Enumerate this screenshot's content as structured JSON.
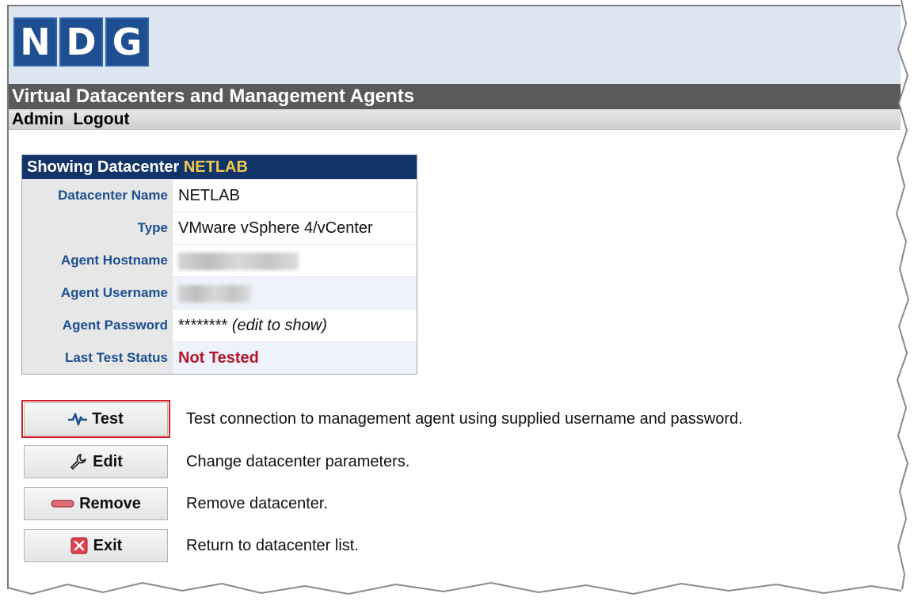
{
  "logo": {
    "letters": [
      "N",
      "D",
      "G"
    ],
    "brand_color": "#1d4f91"
  },
  "app_title": "Virtual Datacenters and Management Agents",
  "menu": {
    "admin": "Admin",
    "logout": "Logout"
  },
  "panel": {
    "title_prefix": "Showing Datacenter",
    "title_name": "NETLAB",
    "rows": [
      {
        "label": "Datacenter Name",
        "value": "NETLAB"
      },
      {
        "label": "Type",
        "value": "VMware vSphere 4/vCenter"
      },
      {
        "label": "Agent Hostname",
        "value": ""
      },
      {
        "label": "Agent Username",
        "value": ""
      },
      {
        "label": "Agent Password",
        "value": "********",
        "note": "(edit to show)"
      },
      {
        "label": "Last Test Status",
        "value": "Not Tested"
      }
    ]
  },
  "actions": [
    {
      "label": "Test",
      "icon": "pulse-icon",
      "description": "Test connection to management agent using supplied username and password."
    },
    {
      "label": "Edit",
      "icon": "wrench-icon",
      "description": "Change datacenter parameters."
    },
    {
      "label": "Remove",
      "icon": "minus-icon",
      "description": "Remove datacenter."
    },
    {
      "label": "Exit",
      "icon": "close-icon",
      "description": "Return to datacenter list."
    }
  ],
  "colors": {
    "highlight": "#d21f2b",
    "status_error": "#b8142a",
    "panel_header": "#123569",
    "accent_name": "#f2c94c"
  }
}
